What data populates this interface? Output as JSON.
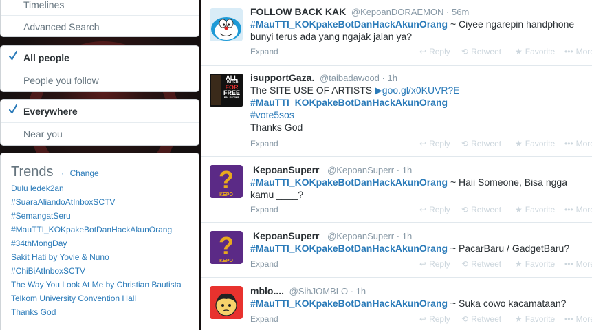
{
  "nav_top": {
    "items": [
      {
        "label": "Timelines"
      },
      {
        "label": "Advanced Search"
      }
    ]
  },
  "people_filter": {
    "items": [
      {
        "label": "All people",
        "selected": true
      },
      {
        "label": "People you follow",
        "selected": false
      }
    ]
  },
  "location_filter": {
    "items": [
      {
        "label": "Everywhere",
        "selected": true
      },
      {
        "label": "Near you",
        "selected": false
      }
    ]
  },
  "trends": {
    "title": "Trends",
    "separator": "·",
    "change_label": "Change",
    "items": [
      "Dulu ledek2an",
      "#SuaraAliandoAtInboxSCTV",
      "#SemangatSeru",
      "#MauTTI_KOKpakeBotDanHackAkunOrang",
      "#34thMongDay",
      "Sakit Hati by Yovie & Nuno",
      "#ChiBiAtInboxSCTV",
      "The Way You Look At Me by Christian Bautista",
      "Telkom University Convention Hall",
      "Thanks God"
    ]
  },
  "actions": {
    "expand": "Expand",
    "reply": "Reply",
    "retweet": "Retweet",
    "favorite": "Favorite",
    "more": "More"
  },
  "tweets": [
    {
      "name": "FOLLOW BACK KAK",
      "handle": "@KepoanDORAEMON",
      "time": "56m",
      "hashtag": "#MauTTI_KOKpakeBotDanHackAkunOrang",
      "text_after": " ~ Ciyee ngarepin handphone bunyi terus ada yang ngajak jalan ya?"
    },
    {
      "name": "isupportGaza.",
      "handle": "@taibadawood",
      "time": "1h",
      "line1": "The SITE USE OF ARTISTS ",
      "link": "▶goo.gl/x0KUVR?E",
      "hashtag": "#MauTTI_KOKpakeBotDanHackAkunOrang",
      "hashtag2": "#vote5sos",
      "line_last": "Thanks God",
      "avatar_text": [
        "ALL",
        "UNITED",
        "FOR",
        "FREE",
        "PALESTINE"
      ]
    },
    {
      "name": "KepoanSuperr",
      "handle": "@KepoanSuperr",
      "time": "1h",
      "hashtag": "#MauTTI_KOKpakeBotDanHackAkunOrang",
      "text_after": " ~ Haii Someone, Bisa ngga kamu ____?",
      "avatar_text": "KEPO"
    },
    {
      "name": "KepoanSuperr",
      "handle": "@KepoanSuperr",
      "time": "1h",
      "hashtag": "#MauTTI_KOKpakeBotDanHackAkunOrang",
      "text_after": " ~ PacarBaru / GadgetBaru?",
      "avatar_text": "KEPO"
    },
    {
      "name": "mblo....",
      "handle": "@SihJOMBLO",
      "time": "1h",
      "hashtag": "#MauTTI_KOKpakeBotDanHackAkunOrang",
      "text_after": " ~ Suka cowo kacamataan?"
    }
  ],
  "colors": {
    "link": "#2b7bb9",
    "check": "#2b7bb9",
    "muted": "#8899a6"
  }
}
